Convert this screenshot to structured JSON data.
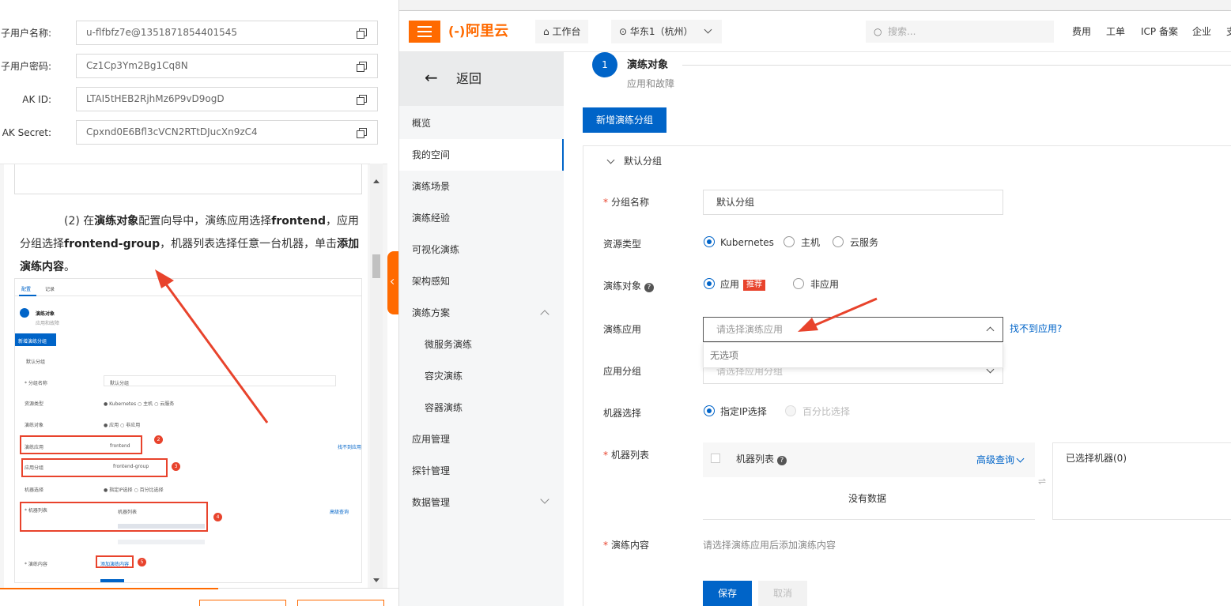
{
  "credentials": {
    "username_label": "子用户名称:",
    "username_value": "u-flfbfz7e@1351871854401545",
    "password_label": "子用户密码:",
    "password_value": "Cz1Cp3Ym2Bg1Cq8N",
    "akid_label": "AK ID:",
    "akid_value": "LTAI5tHEB2RjhMz6P9vD9ogD",
    "aksecret_label": "AK Secret:",
    "aksecret_value": "Cpxnd0E6Bfl3cVCN2RTtDJucXn9zC4"
  },
  "doc": {
    "step": "(2) 在",
    "b1": "演练对象",
    "t1": "配置向导中，演练应用选择",
    "b2": "frontend",
    "t2": "，应用分组选择",
    "b3": "frontend-group",
    "t3": "，机器列表选择任意一台机器，单击",
    "b4": "添加演练内容",
    "t4": "。"
  },
  "mini": {
    "tab1": "配置",
    "tab2": "记录",
    "step_title": "演练对象",
    "step_sub": "应用和故障",
    "new_group": "新增演练分组",
    "default_group": "默认分组",
    "group_name_label": "* 分组名称",
    "group_name_value": "默认分组",
    "res_type_label": "资源类型",
    "res_opts": "● Kubernetes  ○ 主机  ○ 云服务",
    "target_label": "演练对象",
    "target_opts": "● 应用  ○ 非应用",
    "app_label": "演练应用",
    "app_value": "frontend",
    "not_found": "找不到应用",
    "group_label": "应用分组",
    "group_value": "frontend-group",
    "machine_label": "机器选择",
    "machine_opts": "● 指定IP选择  ○ 百分比选择",
    "list_label": "* 机器列表",
    "list_header": "机器列表",
    "adv_query": "高级查询",
    "content_label": "* 演练内容",
    "add_content": "添加演练内容",
    "n2": "2",
    "n3": "3",
    "n4": "4",
    "n5": "5"
  },
  "topbar": {
    "logo": "阿里云",
    "workbench": "工作台",
    "region": "华东1（杭州）",
    "search_placeholder": "搜索...",
    "links": [
      "费用",
      "工单",
      "ICP 备案",
      "企业",
      "支"
    ]
  },
  "sidenav": {
    "back": "返回",
    "items": [
      "概览",
      "我的空间",
      "演练场景",
      "演练经验",
      "可视化演练",
      "架构感知",
      "演练方案",
      "微服务演练",
      "容灾演练",
      "容器演练",
      "应用管理",
      "探针管理",
      "数据管理"
    ]
  },
  "form": {
    "step_num": "1",
    "step_title": "演练对象",
    "step_sub": "应用和故障",
    "new_group_btn": "新增演练分组",
    "default_group": "默认分组",
    "group_name_label": "分组名称",
    "group_name_value": "默认分组",
    "res_type_label": "资源类型",
    "res_k8s": "Kubernetes",
    "res_host": "主机",
    "res_cloud": "云服务",
    "target_label": "演练对象",
    "target_app": "应用",
    "target_badge": "推荐",
    "target_nonapp": "非应用",
    "app_label": "演练应用",
    "app_placeholder": "请选择演练应用",
    "not_found_link": "找不到应用?",
    "dropdown_empty": "无选项",
    "group_label": "应用分组",
    "group_placeholder": "请选择应用分组",
    "machine_label": "机器选择",
    "machine_ip": "指定IP选择",
    "machine_pct": "百分比选择",
    "list_label": "机器列表",
    "list_header": "机器列表",
    "adv_query": "高级查询",
    "no_data": "没有数据",
    "selected": "已选择机器(0)",
    "content_label": "演练内容",
    "content_hint": "请选择演练应用后添加演练内容",
    "save": "保存",
    "cancel": "取消"
  },
  "colors": {
    "brand": "#ff6a00",
    "primary": "#0064c8",
    "annotation": "#e8432c"
  }
}
